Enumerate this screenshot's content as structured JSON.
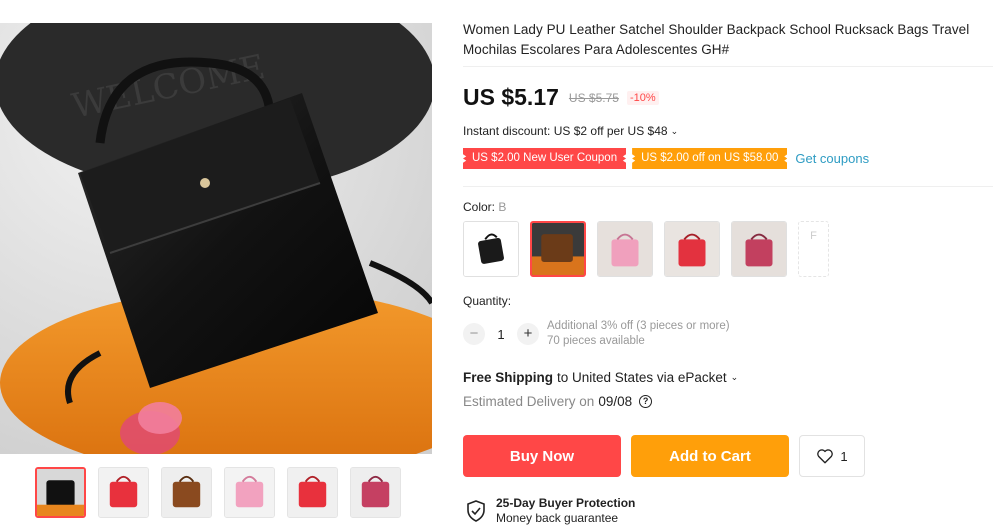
{
  "product": {
    "title": "Women Lady PU Leather Satchel Shoulder Backpack School Rucksack Bags Travel Mochilas Escolares Para Adolescentes GH#",
    "price": "US $5.17",
    "original_price": "US $5.75",
    "discount": "-10%"
  },
  "promotions": {
    "instant_discount": "Instant discount: US $2 off per US $48",
    "coupons": [
      "US $2.00 New User Coupon",
      "US $2.00 off on US $58.00"
    ],
    "get_coupons_label": "Get coupons"
  },
  "color": {
    "label": "Color:",
    "selected_value": "B",
    "options": [
      "A",
      "B",
      "C",
      "D",
      "E",
      "F"
    ],
    "last_option_text": "F"
  },
  "quantity": {
    "label": "Quantity:",
    "value": "1",
    "minus": "−",
    "plus": "+",
    "note_line1": "Additional 3% off (3 pieces or more)",
    "note_line2": "70 pieces available"
  },
  "shipping": {
    "bold": "Free Shipping",
    "rest": "to United States via ePacket",
    "delivery_label": "Estimated Delivery on",
    "delivery_date": "09/08",
    "help_glyph": "?"
  },
  "actions": {
    "buy_now": "Buy Now",
    "add_to_cart": "Add to Cart",
    "wishlist_count": "1"
  },
  "protection": {
    "title": "25-Day Buyer Protection",
    "subtitle": "Money back guarantee"
  },
  "gallery": {
    "watermark_text": "WELCOME",
    "thumbnail_count": 6,
    "active_thumbnail": 1
  },
  "colors": {
    "accent_red": "#ff4747",
    "accent_orange": "#ff9f0a",
    "link_blue": "#2e9cc3"
  }
}
